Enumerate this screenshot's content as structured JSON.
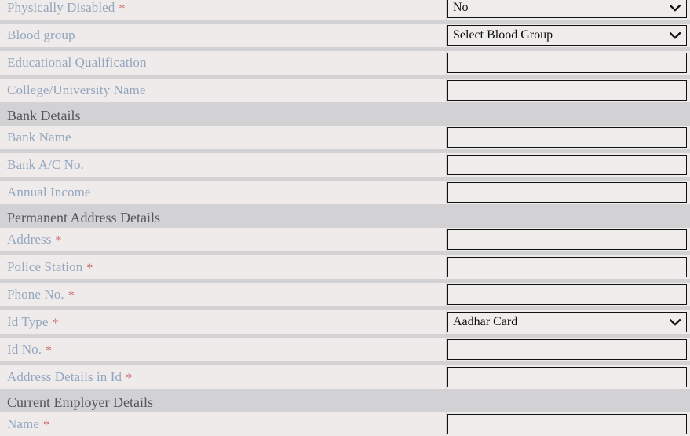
{
  "colors": {
    "page_background": "#d2d2d4",
    "row_background": "#eeebea",
    "label_text": "#93a6bf",
    "required_marker": "#cf6d6d",
    "section_header_text": "#555658",
    "input_border": "#111111",
    "input_background": "#efedec"
  },
  "required_marker": "*",
  "icons": {
    "dropdown": "chevron-down-icon"
  },
  "form": {
    "rows": [
      {
        "kind": "field",
        "name": "physically-disabled",
        "label": "Physically Disabled",
        "required": true,
        "control": "select",
        "value": "No"
      },
      {
        "kind": "field",
        "name": "blood-group",
        "label": "Blood group",
        "required": false,
        "control": "select",
        "value": "Select Blood Group"
      },
      {
        "kind": "field",
        "name": "educational-qualification",
        "label": "Educational Qualification",
        "required": false,
        "control": "text",
        "value": "",
        "placeholder": ""
      },
      {
        "kind": "field",
        "name": "college-university-name",
        "label": "College/University Name",
        "required": false,
        "control": "text",
        "value": "",
        "placeholder": ""
      },
      {
        "kind": "section",
        "name": "bank-details",
        "label": "Bank Details"
      },
      {
        "kind": "field",
        "name": "bank-name",
        "label": "Bank Name",
        "required": false,
        "control": "text",
        "value": "",
        "placeholder": ""
      },
      {
        "kind": "field",
        "name": "bank-ac-no",
        "label": "Bank A/C No.",
        "required": false,
        "control": "text",
        "value": "",
        "placeholder": ""
      },
      {
        "kind": "field",
        "name": "annual-income",
        "label": "Annual Income",
        "required": false,
        "control": "text",
        "value": "",
        "placeholder": ""
      },
      {
        "kind": "section",
        "name": "permanent-address-details",
        "label": "Permanent Address Details"
      },
      {
        "kind": "field",
        "name": "address",
        "label": "Address",
        "required": true,
        "control": "text",
        "value": "",
        "placeholder": ""
      },
      {
        "kind": "field",
        "name": "police-station",
        "label": "Police Station",
        "required": true,
        "control": "text",
        "value": "",
        "placeholder": ""
      },
      {
        "kind": "field",
        "name": "phone-no",
        "label": "Phone No.",
        "required": true,
        "control": "text",
        "value": "",
        "placeholder": ""
      },
      {
        "kind": "field",
        "name": "id-type",
        "label": "Id Type",
        "required": true,
        "control": "select",
        "value": "Aadhar Card"
      },
      {
        "kind": "field",
        "name": "id-no",
        "label": "Id No.",
        "required": true,
        "control": "text",
        "value": "",
        "placeholder": ""
      },
      {
        "kind": "field",
        "name": "address-details-in-id",
        "label": "Address Details in Id",
        "required": true,
        "control": "text",
        "value": "",
        "placeholder": ""
      },
      {
        "kind": "section",
        "name": "current-employer-details",
        "label": "Current Employer Details"
      },
      {
        "kind": "field",
        "name": "employer-name",
        "label": "Name",
        "required": true,
        "control": "text",
        "value": "",
        "placeholder": ""
      }
    ]
  }
}
